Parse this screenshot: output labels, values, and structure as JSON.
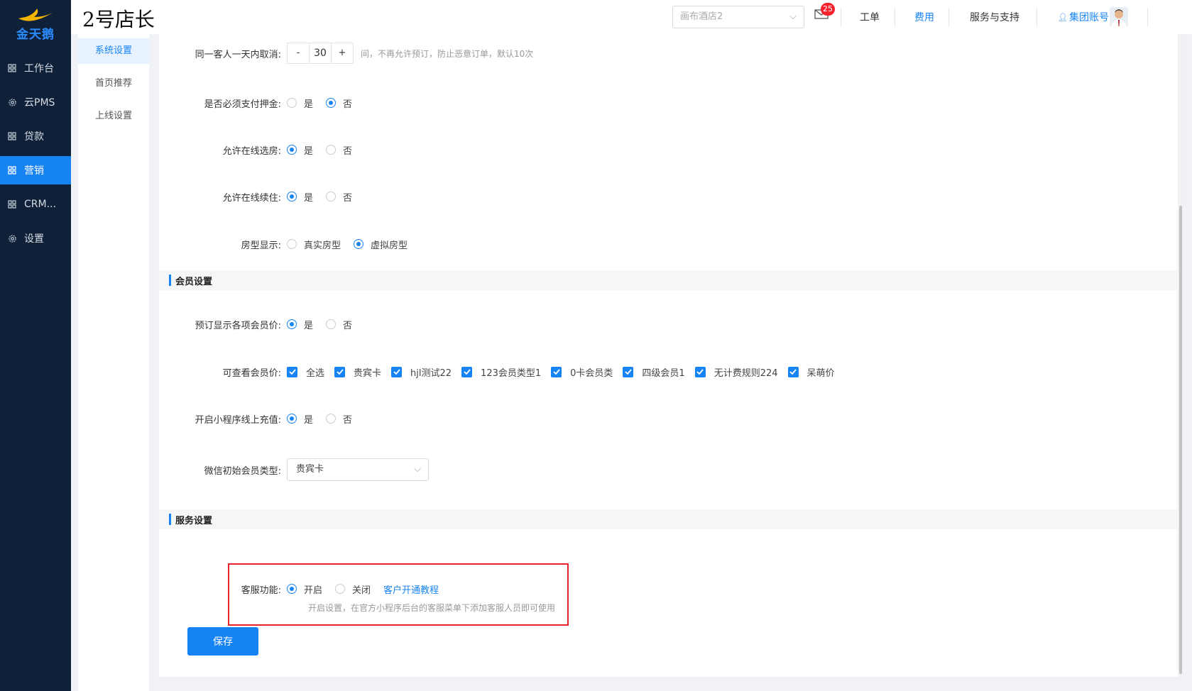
{
  "brand": {
    "logo_text": "金天鹅",
    "accent": "#1784f5",
    "sidebar_bg": "#0f2039"
  },
  "sidebar": {
    "items": [
      {
        "label": "工作台",
        "icon": "grid-icon",
        "active": false
      },
      {
        "label": "云PMS",
        "icon": "gear-icon",
        "active": false
      },
      {
        "label": "贷款",
        "icon": "grid-icon",
        "active": false
      },
      {
        "label": "营销",
        "icon": "grid-icon",
        "active": true
      },
      {
        "label": "CRM...",
        "icon": "grid-icon",
        "active": false
      },
      {
        "label": "设置",
        "icon": "gear-icon",
        "active": false
      }
    ]
  },
  "header": {
    "store_title": "2号店长",
    "hotel_select": {
      "placeholder": "画布酒店2"
    },
    "mail_badge": "25",
    "links": {
      "work_order": "工单",
      "fees": "费用",
      "support": "服务与支持",
      "account": "集团账号"
    }
  },
  "submenu": {
    "items": [
      {
        "label": "系统设置",
        "active": true
      },
      {
        "label": "首页推荐",
        "active": false
      },
      {
        "label": "上线设置",
        "active": false
      }
    ]
  },
  "form": {
    "cancel_limit": {
      "label": "同一客人一天内取消:",
      "value": "30",
      "minus": "-",
      "plus": "+",
      "hint": "间，不再允许预订，防止恶意订单，默认10次"
    },
    "deposit": {
      "label": "是否必须支付押金:",
      "yes": "是",
      "no": "否",
      "selected": "no"
    },
    "online_room": {
      "label": "允许在线选房:",
      "yes": "是",
      "no": "否",
      "selected": "yes"
    },
    "online_extend": {
      "label": "允许在线续住:",
      "yes": "是",
      "no": "否",
      "selected": "yes"
    },
    "room_type_display": {
      "label": "房型显示:",
      "real": "真实房型",
      "virtual": "虚拟房型",
      "selected": "virtual"
    },
    "member_section": {
      "title": "会员设置"
    },
    "show_member_price": {
      "label": "预订显示各项会员价:",
      "yes": "是",
      "no": "否",
      "selected": "yes"
    },
    "view_member_price": {
      "label": "可查看会员价:",
      "options": [
        "全选",
        "贵宾卡",
        "hjl测试22",
        "123会员类型1",
        "0卡会员类",
        "四级会员1",
        "无计费规则224",
        "呆萌价"
      ]
    },
    "mini_recharge": {
      "label": "开启小程序线上充值:",
      "yes": "是",
      "no": "否",
      "selected": "yes"
    },
    "wechat_member_type": {
      "label": "微信初始会员类型:",
      "value": "贵宾卡"
    },
    "service_section": {
      "title": "服务设置"
    },
    "customer_service": {
      "label": "客服功能:",
      "on": "开启",
      "off": "关闭",
      "selected": "on",
      "tutorial_link": "客户开通教程",
      "hint": "开启设置，在官方小程序后台的客服菜单下添加客服人员即可使用"
    },
    "save_label": "保存"
  }
}
